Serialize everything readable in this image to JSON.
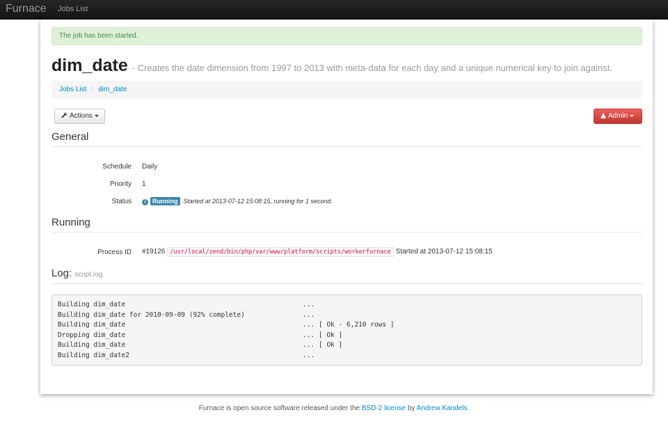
{
  "navbar": {
    "brand": "Furnace",
    "links": [
      "Jobs List"
    ]
  },
  "alert": {
    "message": "The job has been started."
  },
  "header": {
    "title": "dim_date",
    "subtitle": "- Creates the date dimension from 1997 to 2013 with meta-data for each day and a unique numerical key to join against."
  },
  "breadcrumb": {
    "items": [
      "Jobs List",
      "dim_date"
    ],
    "separator": "/"
  },
  "toolbar": {
    "actions_label": "Actions",
    "admin_label": "Admin"
  },
  "general": {
    "heading": "General",
    "schedule_label": "Schedule",
    "schedule_value": "Daily",
    "priority_label": "Priority",
    "priority_value": "1",
    "status_label": "Status",
    "status_badge": "Running",
    "status_text": "Started at 2013-07-12 15:08:15, running for 1 second.",
    "status_icon": "info-icon"
  },
  "running": {
    "heading": "Running",
    "pid_label": "Process ID",
    "pid_value": "#19126",
    "path": "/usr/local/zend/bin/php/var/www/platform/scripts/workerfurnace",
    "started": "Started at 2013-07-12 15:08:15"
  },
  "log": {
    "heading": "Log:",
    "file": "script.log",
    "lines": [
      {
        "message": "Building dim_date",
        "result": "..."
      },
      {
        "message": "Building dim_date for 2010-09-09 (92% complete)",
        "result": "..."
      },
      {
        "message": "Building dim_date",
        "result": "... [ Ok - 6,210 rows ]"
      },
      {
        "message": "Dropping dim_date",
        "result": "... [ Ok ]"
      },
      {
        "message": "Building dim_date",
        "result": "... [ Ok ]"
      },
      {
        "message": "Building dim_date2",
        "result": "..."
      }
    ]
  },
  "footer": {
    "text_before": "Furnace is open source software released under the",
    "license_link": "BSD-2 license",
    "text_middle": "by",
    "author_link": "Andrew Kandels",
    "text_after": "."
  },
  "colors": {
    "alert_bg": "#dff0d8",
    "admin_button": "#da4f49",
    "running_badge": "#3a87ad",
    "link": "#0088cc",
    "code": "#d14"
  }
}
